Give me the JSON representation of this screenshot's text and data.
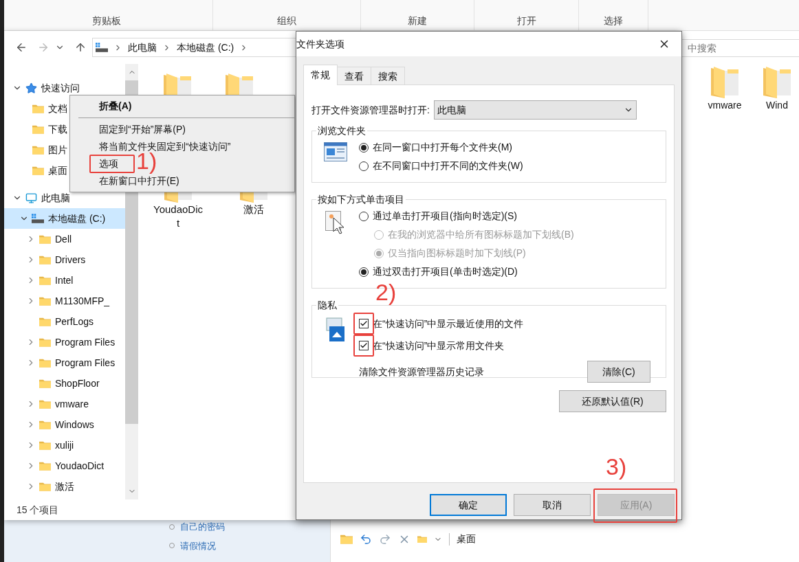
{
  "ribbon": {
    "groups": [
      "剪贴板",
      "组织",
      "新建",
      "打开",
      "选择"
    ]
  },
  "explorer": {
    "address": [
      "此电脑",
      "本地磁盘 (C:)"
    ],
    "nav": [
      {
        "label": "快速访问",
        "kind": "star",
        "selected": false,
        "expanded": true,
        "children": [
          {
            "label": "文档",
            "kind": "folder",
            "selected": false
          },
          {
            "label": "下载",
            "kind": "folder",
            "selected": false
          },
          {
            "label": "图片",
            "kind": "folder",
            "selected": false
          },
          {
            "label": "桌面",
            "kind": "folder",
            "selected": false
          }
        ]
      },
      {
        "label": "此电脑",
        "kind": "monitor",
        "selected": false,
        "expanded": true,
        "children": [
          {
            "label": "本地磁盘 (C:)",
            "kind": "drive",
            "selected": true,
            "expanded": true,
            "children": [
              {
                "label": "Dell",
                "kind": "folder",
                "selected": false,
                "expandable": true
              },
              {
                "label": "Drivers",
                "kind": "folder",
                "selected": false,
                "expandable": true
              },
              {
                "label": "Intel",
                "kind": "folder",
                "selected": false,
                "expandable": true
              },
              {
                "label": "M1130MFP_",
                "kind": "folder",
                "selected": false,
                "expandable": true
              },
              {
                "label": "PerfLogs",
                "kind": "folder",
                "selected": false,
                "expandable": false
              },
              {
                "label": "Program Files",
                "kind": "folder",
                "selected": false,
                "expandable": true
              },
              {
                "label": "Program Files",
                "kind": "folder",
                "selected": false,
                "expandable": true
              },
              {
                "label": "ShopFloor",
                "kind": "folder",
                "selected": false,
                "expandable": false
              },
              {
                "label": "vmware",
                "kind": "folder",
                "selected": false,
                "expandable": true
              },
              {
                "label": "Windows",
                "kind": "folder",
                "selected": false,
                "expandable": true
              },
              {
                "label": "xuliji",
                "kind": "folder",
                "selected": false,
                "expandable": true
              },
              {
                "label": "YoudaoDict",
                "kind": "folder",
                "selected": false,
                "expandable": true
              },
              {
                "label": "激活",
                "kind": "folder",
                "selected": false,
                "expandable": true
              }
            ]
          }
        ]
      }
    ],
    "files": [
      {
        "label": "YoudaoDict"
      },
      {
        "label": "激活"
      }
    ],
    "status": "15 个项目"
  },
  "context_menu": {
    "items": [
      {
        "kind": "header",
        "label": "折叠(A)",
        "highlighted": false
      },
      {
        "kind": "separator"
      },
      {
        "kind": "item",
        "label": "固定到“开始”屏幕(P)",
        "highlighted": false
      },
      {
        "kind": "item",
        "label": "将当前文件夹固定到“快速访问”",
        "highlighted": false
      },
      {
        "kind": "item",
        "label": "选项",
        "highlighted": true,
        "callout": "1)"
      },
      {
        "kind": "item",
        "label": "在新窗口中打开(E)",
        "highlighted": false
      }
    ]
  },
  "dialog": {
    "title": "文件夹选项",
    "tabs": [
      {
        "label": "常规",
        "selected": true
      },
      {
        "label": "查看",
        "selected": false
      },
      {
        "label": "搜索",
        "selected": false
      }
    ],
    "open_in": {
      "label": "打开文件资源管理器时打开:",
      "value": "此电脑"
    },
    "browse": {
      "title": "浏览文件夹",
      "options": [
        {
          "label": "在同一窗口中打开每个文件夹(M)",
          "selected": true,
          "disabled": false
        },
        {
          "label": "在不同窗口中打开不同的文件夹(W)",
          "selected": false,
          "disabled": false
        }
      ]
    },
    "click": {
      "title": "按如下方式单击项目",
      "options": [
        {
          "label": "通过单击打开项目(指向时选定)(S)",
          "selected": false,
          "disabled": false,
          "children": [
            {
              "label": "在我的浏览器中给所有图标标题加下划线(B)",
              "selected": false,
              "disabled": true
            },
            {
              "label": "仅当指向图标标题时加下划线(P)",
              "selected": true,
              "disabled": true
            }
          ]
        },
        {
          "label": "通过双击打开项目(单击时选定)(D)",
          "selected": true,
          "disabled": false
        }
      ]
    },
    "privacy": {
      "title": "隐私",
      "callout": "2)",
      "checkboxes": [
        {
          "label": "在“快速访问”中显示最近使用的文件",
          "checked": true,
          "highlighted": true
        },
        {
          "label": "在“快速访问”中显示常用文件夹",
          "checked": true,
          "highlighted": true
        }
      ],
      "clear_label": "清除文件资源管理器历史记录",
      "clear_button": "清除(C)"
    },
    "restore_button": "还原默认值(R)",
    "buttons": [
      {
        "label": "确定",
        "default": true,
        "disabled": false,
        "highlighted": false
      },
      {
        "label": "取消",
        "default": false,
        "disabled": false,
        "highlighted": false
      },
      {
        "label": "应用(A)",
        "default": false,
        "disabled": true,
        "highlighted": true,
        "callout": "3)"
      }
    ]
  },
  "right_window": {
    "search_placeholder": "中搜索",
    "files": [
      {
        "label": "vmware"
      },
      {
        "label": "Wind"
      }
    ]
  },
  "background": {
    "links": [
      "自己的密码",
      "请假情况"
    ],
    "toolbar_label": "桌面"
  }
}
